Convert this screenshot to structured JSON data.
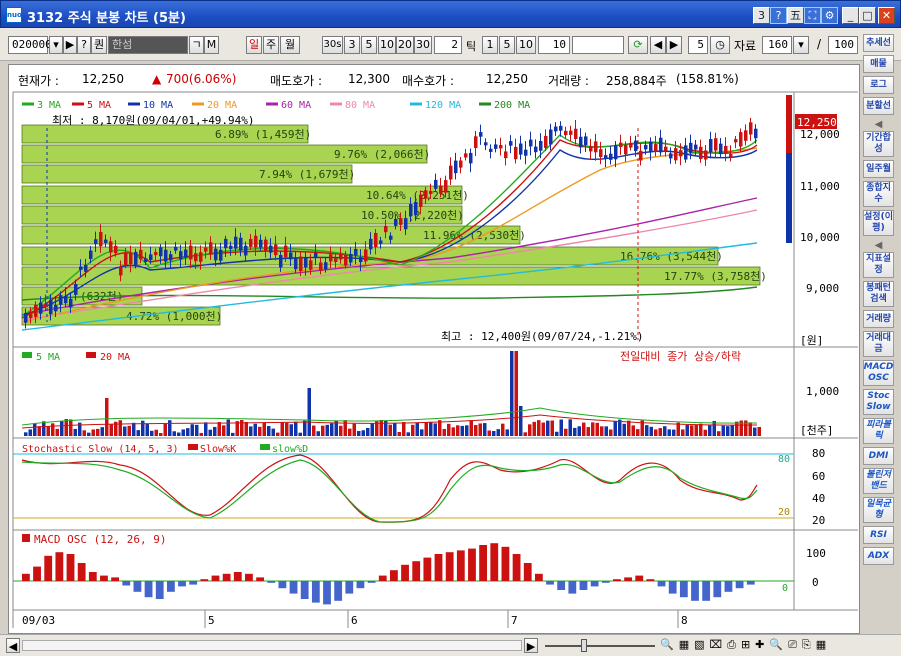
{
  "window": {
    "title": "3132 주식 분봉 차트 (5분)",
    "buttons": [
      "3",
      "?",
      "五"
    ]
  },
  "toolbar": {
    "code": "020000",
    "nav_prev": "◀",
    "nav_next": "▶",
    "question": "?",
    "bang": "퀀",
    "stock_name": "한섬",
    "jump_g": "ㄱ",
    "jump_m": "M",
    "period_day": "일",
    "period_week": "주",
    "period_month": "월",
    "sec_30": "30s",
    "min_buttons": [
      "3",
      "5",
      "10",
      "20",
      "30"
    ],
    "min_input": "2",
    "tick_label": "틱",
    "tick_buttons": [
      "1",
      "5",
      "10"
    ],
    "tick_input": "10",
    "count_input": "5",
    "data_label": "자료",
    "data_count": "160",
    "slash": "/",
    "total": "100"
  },
  "info": {
    "price_label": "현재가 :",
    "price": "12,250",
    "change": "700(6.06%)",
    "ask_label": "매도호가 :",
    "ask": "12,300",
    "bid_label": "매수호가 :",
    "bid": "12,250",
    "vol_label": "거래량 :",
    "vol": "258,884주",
    "vol_pct": "(158.81%)"
  },
  "legend_ma": [
    {
      "name": "3 MA",
      "color": "#22aa22"
    },
    {
      "name": "5 MA",
      "color": "#cc1111"
    },
    {
      "name": "10 MA",
      "color": "#1133aa"
    },
    {
      "name": "20 MA",
      "color": "#ee9922"
    },
    {
      "name": "60 MA",
      "color": "#aa22aa"
    },
    {
      "name": "80 MA",
      "color": "#ee88aa"
    },
    {
      "name": "120 MA",
      "color": "#22bbdd"
    },
    {
      "name": "200 MA",
      "color": "#228822"
    }
  ],
  "annotations": {
    "low": "최저 : 8,170원(09/04/01,+49.94%)",
    "high": "최고 : 12,400원(09/07/24,-1.21%)",
    "bands": [
      "6.89% (1,459천)",
      "9.76% (2,066천)",
      "7.94% (1,679천)",
      "10.64% (2,251천)",
      "10.50% (2,220천)",
      "11.96% (2,530천)",
      "16.76% (3,544천)",
      "17.77% (3,758천)",
      "4.72% (1,000천)",
      "(632천)"
    ],
    "current_tag": "12,250"
  },
  "price_axis": {
    "ticks": [
      "12,000",
      "11,000",
      "10,000",
      "9,000"
    ],
    "unit": "[원]"
  },
  "volume_panel": {
    "legend": [
      {
        "name": "5 MA",
        "color": "#22aa22"
      },
      {
        "name": "20 MA",
        "color": "#cc1111"
      }
    ],
    "note": "전일대비 종가 상승/하락",
    "ticks": [
      "1,000"
    ],
    "unit": "[천주]"
  },
  "stoch_panel": {
    "legend": [
      {
        "name": "Stochastic Slow (14, 5, 3)",
        "color": "#cc1111"
      },
      {
        "name": "Slow%K",
        "color": "#cc1111"
      },
      {
        "name": "slow%D",
        "color": "#22aa22"
      }
    ],
    "ticks": [
      "80",
      "60",
      "40",
      "20"
    ],
    "right_labels": [
      "80",
      "20"
    ]
  },
  "macd_panel": {
    "legend": "MACD OSC (12, 26, 9)",
    "ticks": [
      "100",
      "0"
    ],
    "zero_label": "0"
  },
  "date_axis": [
    "09/03",
    "5",
    "6",
    "7",
    "8"
  ],
  "sidebar": [
    "추세선",
    "매물",
    "로그",
    "분할선",
    "기간합성",
    "일주월",
    "종합지수",
    "설정(이평)",
    "지표설정",
    "봉패턴검색",
    "거래량",
    "거래대금",
    "MACD OSC",
    "Stoc Slow",
    "피라볼릭",
    "DMI",
    "볼린저밴드",
    "일목균형",
    "RSI",
    "ADX"
  ]
}
